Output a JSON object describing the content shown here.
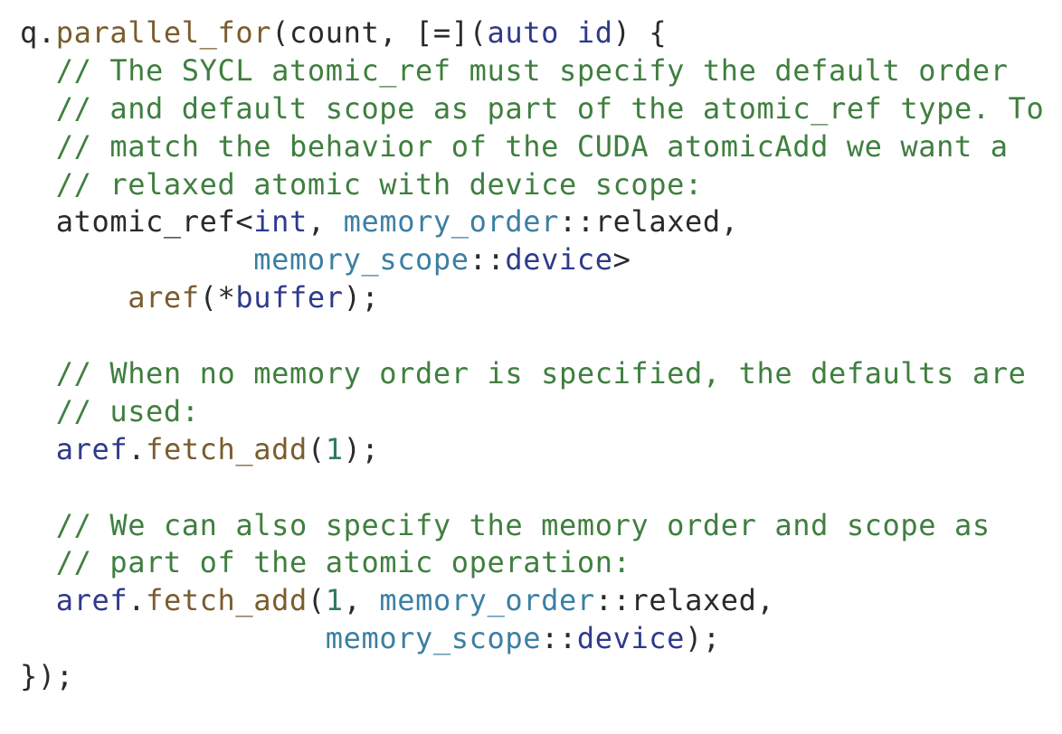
{
  "code": {
    "lines": [
      [
        {
          "t": "q.",
          "c": "id"
        },
        {
          "t": "parallel_for",
          "c": "fn"
        },
        {
          "t": "(count, [=](",
          "c": "id"
        },
        {
          "t": "auto",
          "c": "kw"
        },
        {
          "t": " ",
          "c": "id"
        },
        {
          "t": "id",
          "c": "kw"
        },
        {
          "t": ") {",
          "c": "id"
        }
      ],
      [
        {
          "t": "  // The SYCL atomic_ref must specify the default order",
          "c": "comment"
        }
      ],
      [
        {
          "t": "  // and default scope as part of the atomic_ref type. To",
          "c": "comment"
        }
      ],
      [
        {
          "t": "  // match the behavior of the CUDA atomicAdd we want a",
          "c": "comment"
        }
      ],
      [
        {
          "t": "  // relaxed atomic with device scope:",
          "c": "comment"
        }
      ],
      [
        {
          "t": "  atomic_ref<",
          "c": "id"
        },
        {
          "t": "int",
          "c": "kw"
        },
        {
          "t": ", ",
          "c": "id"
        },
        {
          "t": "memory_order",
          "c": "ty"
        },
        {
          "t": "::relaxed,",
          "c": "id"
        }
      ],
      [
        {
          "t": "             ",
          "c": "id"
        },
        {
          "t": "memory_scope",
          "c": "ty"
        },
        {
          "t": "::",
          "c": "id"
        },
        {
          "t": "device",
          "c": "kw"
        },
        {
          "t": ">",
          "c": "id"
        }
      ],
      [
        {
          "t": "      ",
          "c": "id"
        },
        {
          "t": "aref",
          "c": "fn"
        },
        {
          "t": "(*",
          "c": "id"
        },
        {
          "t": "buffer",
          "c": "kw"
        },
        {
          "t": ");",
          "c": "id"
        }
      ],
      [
        {
          "t": "",
          "c": "id"
        }
      ],
      [
        {
          "t": "  // When no memory order is specified, the defaults are",
          "c": "comment"
        }
      ],
      [
        {
          "t": "  // used:",
          "c": "comment"
        }
      ],
      [
        {
          "t": "  ",
          "c": "id"
        },
        {
          "t": "aref",
          "c": "kw"
        },
        {
          "t": ".",
          "c": "id"
        },
        {
          "t": "fetch_add",
          "c": "fn"
        },
        {
          "t": "(",
          "c": "id"
        },
        {
          "t": "1",
          "c": "num"
        },
        {
          "t": ");",
          "c": "id"
        }
      ],
      [
        {
          "t": "",
          "c": "id"
        }
      ],
      [
        {
          "t": "  // We can also specify the memory order and scope as",
          "c": "comment"
        }
      ],
      [
        {
          "t": "  // part of the atomic operation:",
          "c": "comment"
        }
      ],
      [
        {
          "t": "  ",
          "c": "id"
        },
        {
          "t": "aref",
          "c": "kw"
        },
        {
          "t": ".",
          "c": "id"
        },
        {
          "t": "fetch_add",
          "c": "fn"
        },
        {
          "t": "(",
          "c": "id"
        },
        {
          "t": "1",
          "c": "num"
        },
        {
          "t": ", ",
          "c": "id"
        },
        {
          "t": "memory_order",
          "c": "ty"
        },
        {
          "t": "::relaxed,",
          "c": "id"
        }
      ],
      [
        {
          "t": "                 ",
          "c": "id"
        },
        {
          "t": "memory_scope",
          "c": "ty"
        },
        {
          "t": "::",
          "c": "id"
        },
        {
          "t": "device",
          "c": "kw"
        },
        {
          "t": ");",
          "c": "id"
        }
      ],
      [
        {
          "t": "});",
          "c": "id"
        }
      ]
    ]
  }
}
